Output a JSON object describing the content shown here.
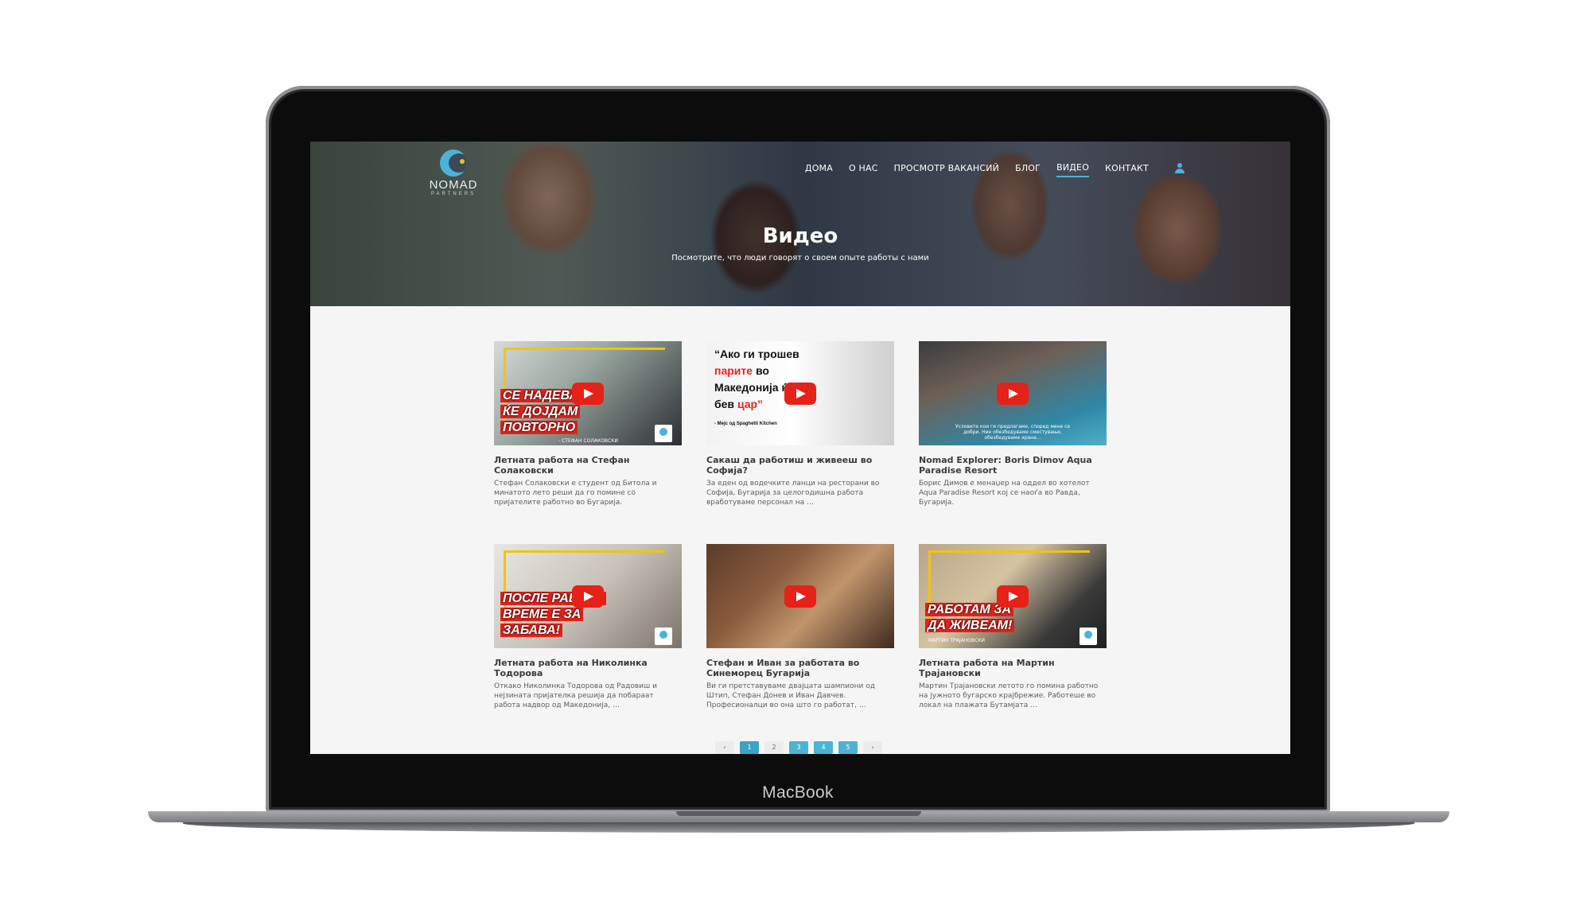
{
  "device": {
    "label": "MacBook"
  },
  "site": {
    "logo": {
      "word": "NOMAD",
      "sub": "PARTNERS"
    },
    "nav": [
      {
        "label": "ДОМА",
        "active": false
      },
      {
        "label": "О НАС",
        "active": false
      },
      {
        "label": "ПРОСМОТР ВАКАНСИЙ",
        "active": false
      },
      {
        "label": "БЛОГ",
        "active": false
      },
      {
        "label": "ВИДЕО",
        "active": true
      },
      {
        "label": "КОНТАКТ",
        "active": false
      }
    ],
    "hero": {
      "title": "Видео",
      "subtitle": "Посмотрите, что люди говорят о своем опыте работы с нами"
    },
    "cards": [
      {
        "title": "Летната работа на Стефан Солаковски",
        "desc": "Стефан Солаковски е студент од Битола и минатото лето реши да го помине со пријателите работно во Бугарија.",
        "thumb_caption": [
          "СЕ НАДЕВАМ",
          "ЌЕ ДОЈДАМ",
          "ПОВТОРНО"
        ],
        "thumb_credit": "- СТЕФАН СОЛАКОВСКИ"
      },
      {
        "title": "Сакаш да работиш и живееш во Софија?",
        "desc": "За еден од водечките ланци на ресторани во Софија, Бугарија за целогодишна работа вработуваме персонал на …",
        "thumb_quote": [
          "“Ако ги трошев",
          "парите",
          "во",
          "Македонија ќе",
          "бев",
          "цар”"
        ],
        "thumb_credit": "- Мејс од Spaghetti Kitchen"
      },
      {
        "title": "Nomad Explorer: Boris Dimov Aqua Paradise Resort",
        "desc": "Борис Димов е менаџер на оддел во хотелот Aqua Paradise Resort кој се наоѓа во Равда, Бугарија.",
        "thumb_overlay": "Условите кои ги предлагаме, според мене се добри. Ние обезбедуваме сместување, обезбедуваме храна..."
      },
      {
        "title": "Летната работа на Николинка Тодорова",
        "desc": "Откако Николинка Тодорова од Радовиш и нејзината пријателка решија да побараат работа надвор од Македонија, …",
        "thumb_caption": [
          "ПОСЛЕ РАБОТА",
          "ВРЕМЕ Е ЗА",
          "ЗАБАВА!"
        ]
      },
      {
        "title": "Стефан и Иван за работата во Синеморец Бугарија",
        "desc": "Ви ги претставуваме двајцата шампиони од Штип, Стефан Донев и Иван Давчев. Професионалци во она што го работат, …"
      },
      {
        "title": "Летната работа на Мартин Трајановски",
        "desc": "Мартин Трајановски летото го помина работно на јужното бугарско крајбрежие. Работеше во локал на плажата Бутамјата …",
        "thumb_caption": [
          "РАБОТАМ ЗА",
          "ДА ЖИВЕАМ!"
        ],
        "thumb_credit": "МАРТИН ТРАЈАНОВСКИ"
      }
    ],
    "pagination": {
      "prev": "‹",
      "pages": [
        "1",
        "2",
        "3",
        "4",
        "5"
      ],
      "current": "1",
      "next": "›"
    }
  }
}
